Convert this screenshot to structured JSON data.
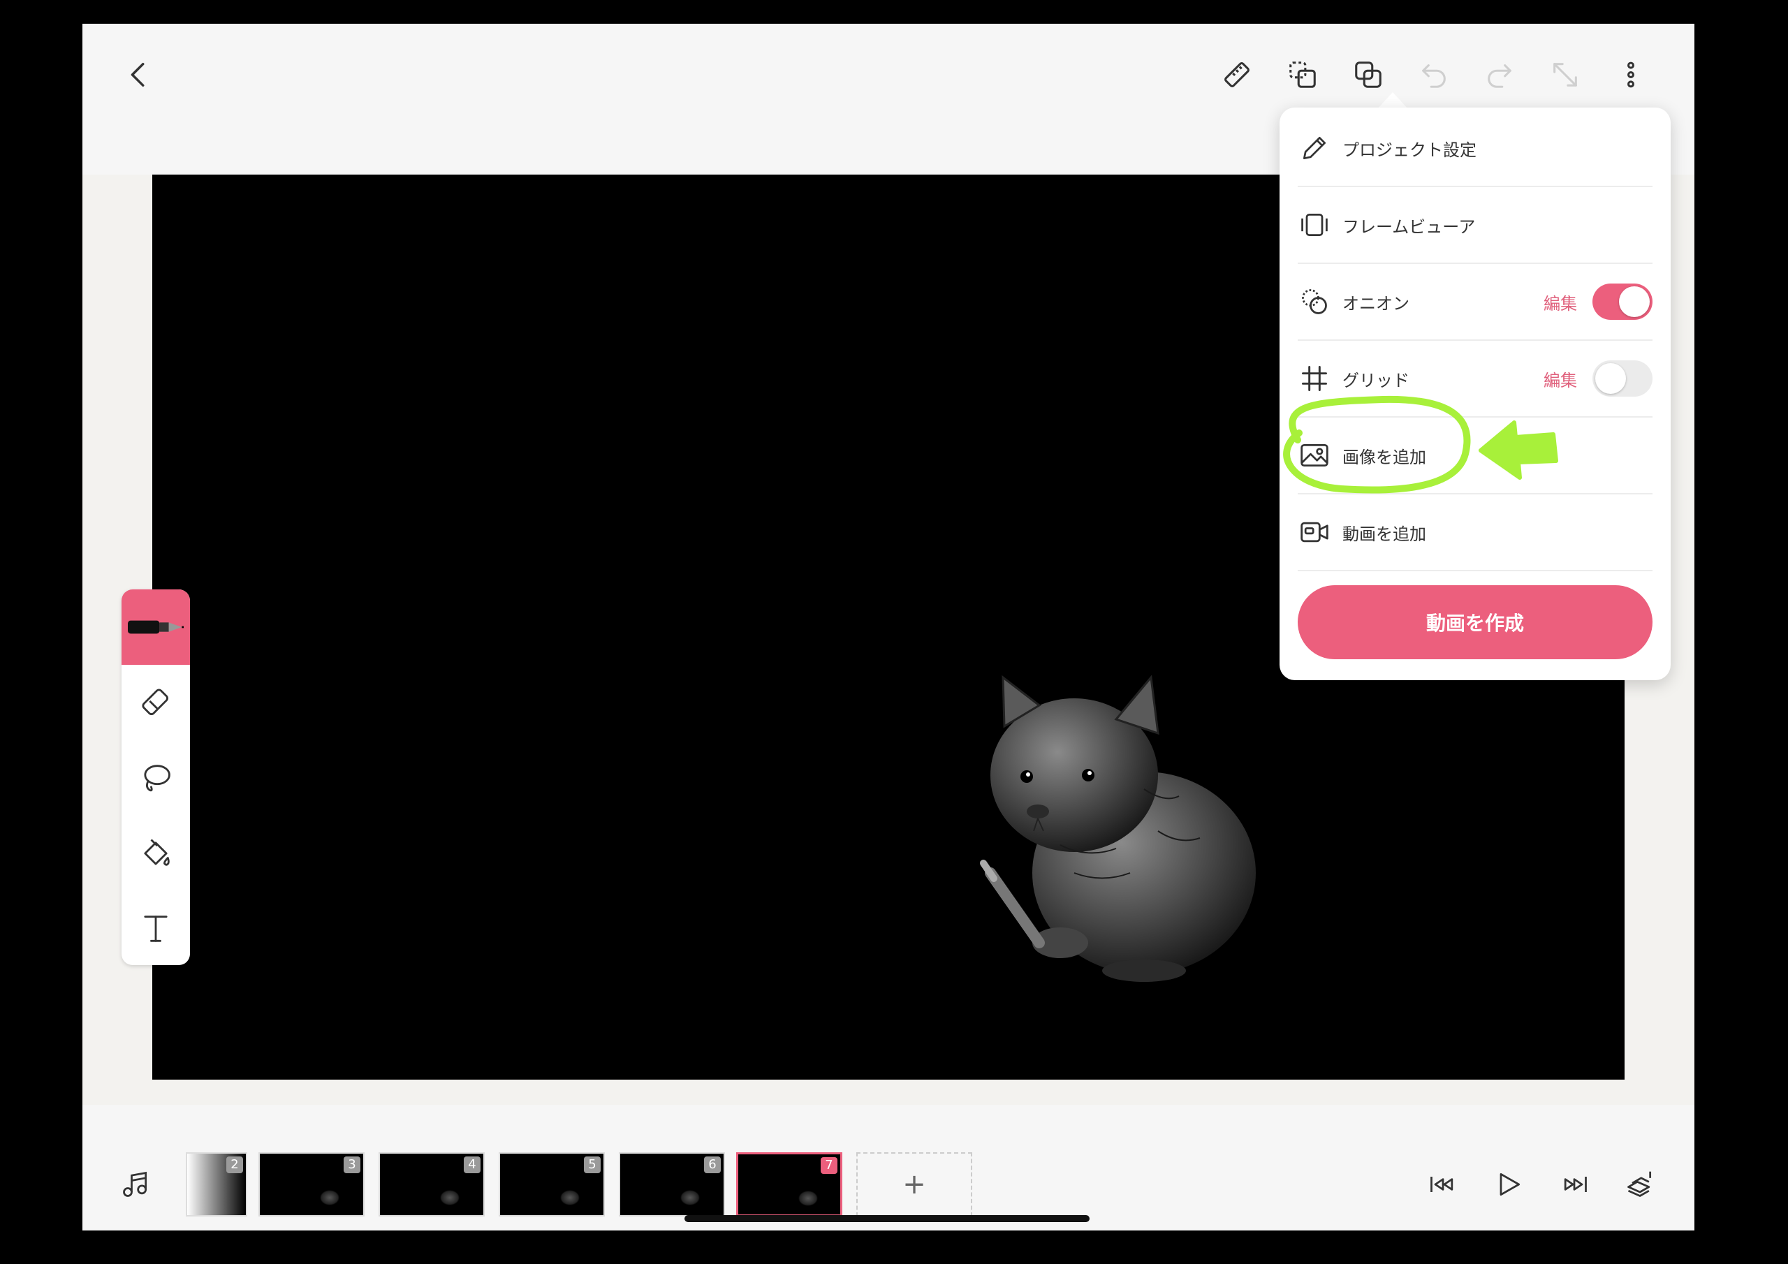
{
  "menu": {
    "items": [
      {
        "label": "プロジェクト設定",
        "icon": "pencil-icon"
      },
      {
        "label": "フレームビューア",
        "icon": "frame-viewer-icon"
      },
      {
        "label": "オニオン",
        "icon": "onion-skin-icon",
        "edit_label": "編集",
        "toggle": "on"
      },
      {
        "label": "グリッド",
        "icon": "grid-hash-icon",
        "edit_label": "編集",
        "toggle": "off"
      },
      {
        "label": "画像を追加",
        "icon": "add-image-icon",
        "highlighted": true
      },
      {
        "label": "動画を追加",
        "icon": "add-video-icon"
      }
    ],
    "primary_button": "動画を作成"
  },
  "topbar": {
    "icons": [
      "back-chevron-icon",
      "ruler-icon",
      "copy-frame-icon",
      "duplicate-icon",
      "undo-icon",
      "redo-icon",
      "resize-icon",
      "more-vertical-icon"
    ]
  },
  "toolbox": {
    "tools": [
      "pen-tool",
      "eraser-tool",
      "lasso-tool",
      "fill-bucket-tool",
      "text-tool"
    ],
    "active": "pen-tool"
  },
  "timeline": {
    "frames": [
      {
        "number": "2"
      },
      {
        "number": "3"
      },
      {
        "number": "4"
      },
      {
        "number": "5"
      },
      {
        "number": "6"
      },
      {
        "number": "7",
        "selected": true
      }
    ],
    "add_label": "+"
  },
  "colors": {
    "accent": "#ec5f7d",
    "annotation": "#a8f03a",
    "canvas": "#000000",
    "panel": "#ffffff"
  }
}
